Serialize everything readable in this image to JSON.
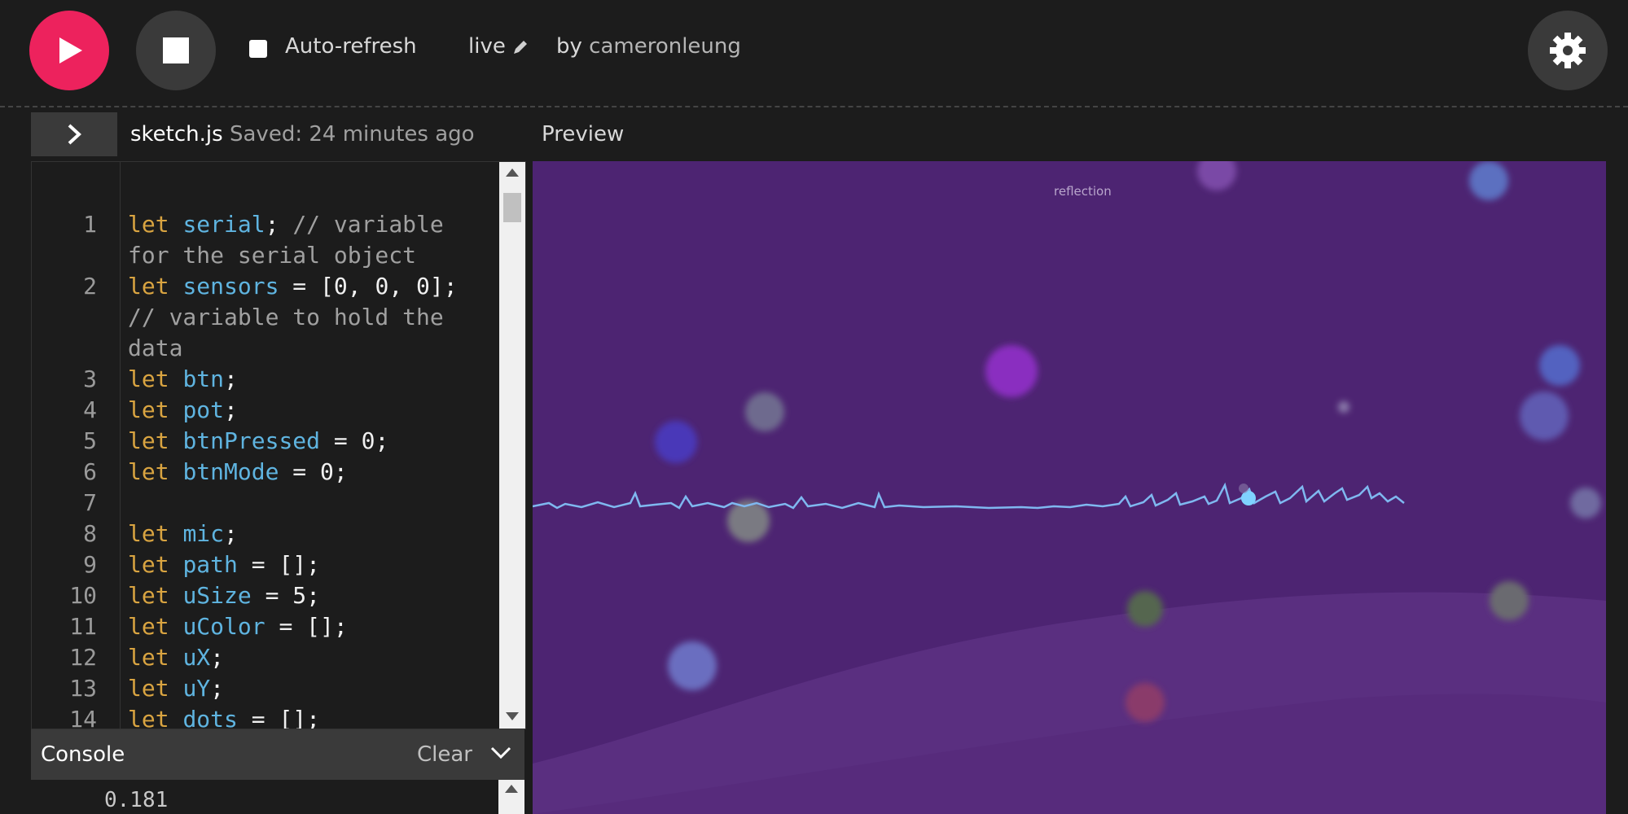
{
  "toolbar": {
    "play_icon": "play-icon",
    "stop_icon": "stop-icon",
    "settings_icon": "gear-icon",
    "auto_refresh_label": "Auto-refresh",
    "auto_refresh_checked": false,
    "sketch_name": "live",
    "by_prefix": "by",
    "author": "cameronleung",
    "accent_color": "#ed225d"
  },
  "editor_tab": {
    "toggle_icon": "chevron-right-icon",
    "file_name": "sketch.js",
    "saved_status": "Saved: 24 minutes ago"
  },
  "preview": {
    "title": "Preview",
    "canvas_caption": "reflection"
  },
  "code": [
    {
      "n": "1",
      "kw": "let",
      "var": "serial",
      "rest": "; ",
      "comment": "// variable"
    },
    {
      "n": "",
      "kw": "",
      "var": "",
      "rest": "",
      "comment": "for the serial object"
    },
    {
      "n": "2",
      "kw": "let",
      "var": "sensors",
      "rest": " = [0, 0, 0];",
      "comment": ""
    },
    {
      "n": "",
      "kw": "",
      "var": "",
      "rest": "",
      "comment": "// variable to hold the"
    },
    {
      "n": "",
      "kw": "",
      "var": "",
      "rest": "",
      "comment": "data"
    },
    {
      "n": "3",
      "kw": "let",
      "var": "btn",
      "rest": ";",
      "comment": ""
    },
    {
      "n": "4",
      "kw": "let",
      "var": "pot",
      "rest": ";",
      "comment": ""
    },
    {
      "n": "5",
      "kw": "let",
      "var": "btnPressed",
      "rest": " = 0;",
      "comment": ""
    },
    {
      "n": "6",
      "kw": "let",
      "var": "btnMode",
      "rest": " = 0;",
      "comment": ""
    },
    {
      "n": "7",
      "kw": "",
      "var": "",
      "rest": "",
      "comment": ""
    },
    {
      "n": "8",
      "kw": "let",
      "var": "mic",
      "rest": ";",
      "comment": ""
    },
    {
      "n": "9",
      "kw": "let",
      "var": "path",
      "rest": " = [];",
      "comment": ""
    },
    {
      "n": "10",
      "kw": "let",
      "var": "uSize",
      "rest": " = 5;",
      "comment": ""
    },
    {
      "n": "11",
      "kw": "let",
      "var": "uColor",
      "rest": " = [];",
      "comment": ""
    },
    {
      "n": "12",
      "kw": "let",
      "var": "uX",
      "rest": ";",
      "comment": ""
    },
    {
      "n": "13",
      "kw": "let",
      "var": "uY",
      "rest": ";",
      "comment": ""
    },
    {
      "n": "14",
      "kw": "let",
      "var": "dots",
      "rest": " = [];",
      "comment": ""
    }
  ],
  "console": {
    "title": "Console",
    "clear_label": "Clear",
    "collapse_icon": "chevron-down-icon",
    "output": "0.181"
  }
}
